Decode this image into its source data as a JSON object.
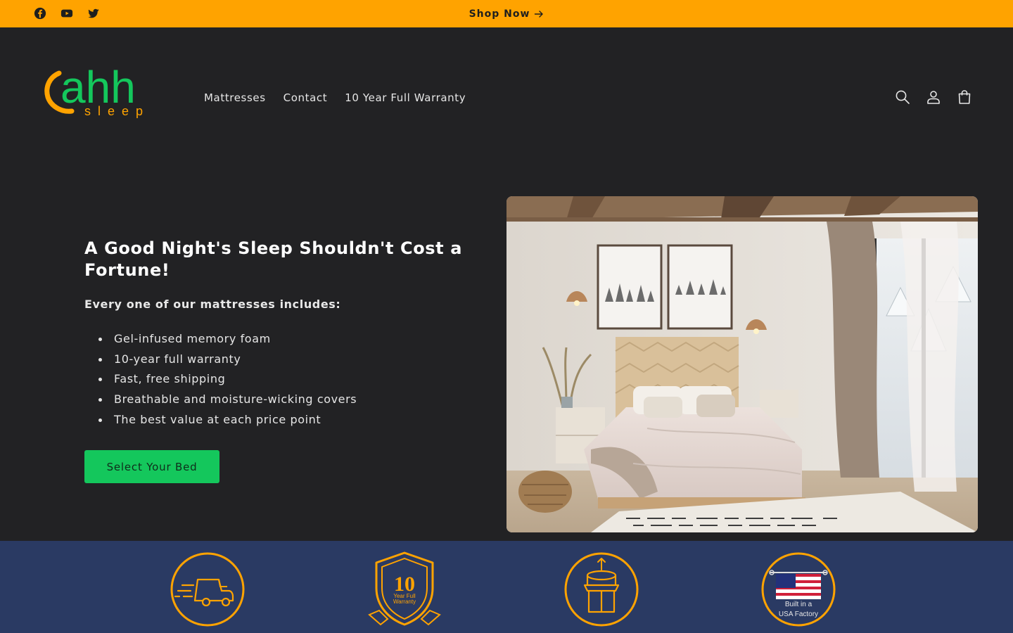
{
  "colors": {
    "announcement_bg": "#ffa300",
    "page_bg": "#222224",
    "cta_bg": "#14c75c",
    "badge_band_bg": "#2a3a63",
    "badge_accent": "#ffa300",
    "logo_green": "#14c75c",
    "logo_orange": "#ffa300"
  },
  "announcement": {
    "social_icons": [
      "facebook-icon",
      "youtube-icon",
      "twitter-icon"
    ],
    "link_label": "Shop Now",
    "link_icon": "arrow-right-icon"
  },
  "header": {
    "logo": {
      "word": "ahh",
      "tagline": "sleep"
    },
    "nav": [
      "Mattresses",
      "Contact",
      "10 Year Full Warranty"
    ],
    "icons": [
      "search-icon",
      "account-icon",
      "cart-icon"
    ]
  },
  "hero": {
    "title": "A Good Night's Sleep Shouldn't Cost a Fortune!",
    "subtitle": "Every one of our mattresses includes:",
    "features": [
      "Gel-infused memory foam",
      "10-year full warranty",
      "Fast, free shipping",
      "Breathable and moisture-wicking covers",
      "The best value at each price point"
    ],
    "cta_label": "Select Your Bed",
    "image": "bedroom-photo"
  },
  "badges": [
    {
      "icon": "delivery-truck-icon"
    },
    {
      "icon": "warranty-shield-icon",
      "number": "10",
      "line1": "Year Full",
      "line2": "Warranty"
    },
    {
      "icon": "mattress-box-icon"
    },
    {
      "icon": "usa-flag-icon",
      "line1": "Built in a",
      "line2": "USA Factory"
    }
  ]
}
